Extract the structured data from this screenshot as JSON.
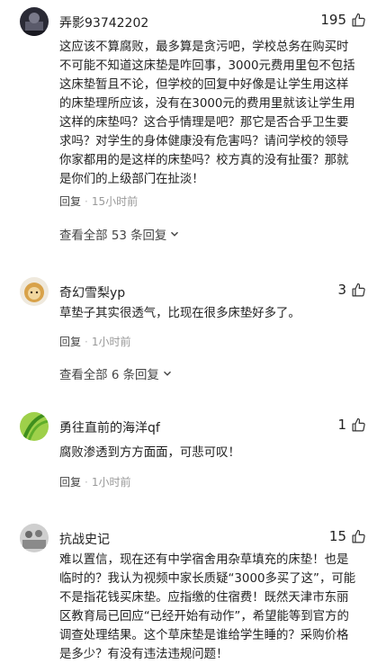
{
  "comments": [
    {
      "username": "弄影93742202",
      "likes": "195",
      "text": "这应该不算腐败，最多算是贪污吧，学校总务在购买时不可能不知道这床垫是咋回事，3000元费用里包不包括这床垫暂且不论，但学校的回复中好像是让学生用这样的床垫理所应该，没有在3000元的费用里就该让学生用这样的床垫吗？这合乎情理是吧？那它是否合乎卫生要求吗？对学生的身体健康没有危害吗？请问学校的领导你家都用的是这样的床垫吗？校方真的没有扯蛋？那就是你们的上级部门在扯淡！",
      "reply_label": "回复",
      "dot": "·",
      "time": "15小时前",
      "more_replies": "查看全部 53 条回复"
    },
    {
      "username": "奇幻雪梨yp",
      "likes": "3",
      "text": "草垫子其实很透气，比现在很多床垫好多了。",
      "reply_label": "回复",
      "dot": "·",
      "time": "1小时前",
      "more_replies": "查看全部 6 条回复"
    },
    {
      "username": "勇往直前的海洋qf",
      "likes": "1",
      "text": "腐败渗透到方方面面，可悲可叹！",
      "reply_label": "回复",
      "dot": "·",
      "time": "1小时前"
    },
    {
      "username": "抗战史记",
      "likes": "15",
      "text": "难以置信，现在还有中学宿舍用杂草填充的床垫！也是临时的？我认为视频中家长质疑“3000多买了这”，可能不是指花钱买床垫。应指缴的住宿费！既然天津市东丽区教育局已回应“已经开始有动作”，希望能等到官方的调查处理结果。这个草床垫是谁给学生睡的？采购价格是多少？有没有违法违规问题！"
    }
  ],
  "icons": {
    "like": "thumbs-up-icon",
    "expand": "chevron-down-icon"
  },
  "colors": {
    "text": "#222222",
    "secondary": "#999999",
    "background": "#ffffff"
  }
}
